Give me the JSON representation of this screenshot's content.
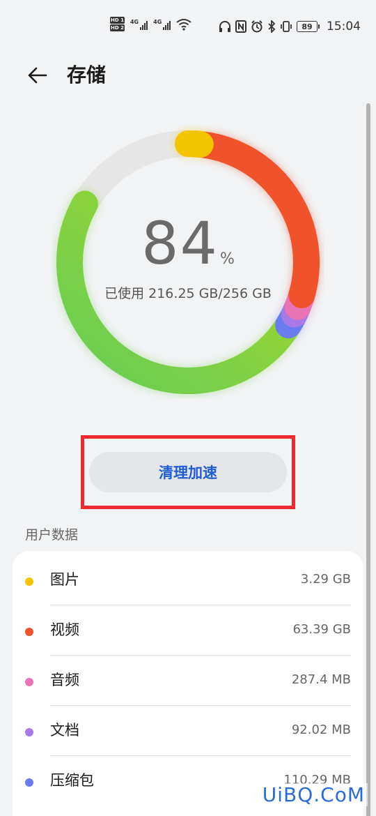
{
  "status_bar": {
    "sim1": "HD 1",
    "sim2": "HD 2",
    "net1": "4G",
    "net2": "4G",
    "battery": "89",
    "time": "15:04",
    "icons": [
      "headphones-icon",
      "nfc-icon",
      "alarm-icon",
      "bluetooth-icon",
      "vibrate-icon"
    ]
  },
  "header": {
    "title": "存储",
    "back_icon": "arrow-left-icon"
  },
  "storage": {
    "percent": "84",
    "percent_unit": "%",
    "used_label": "已使用 216.25 GB/256 GB",
    "used_fraction": 0.84
  },
  "clean_button": {
    "label": "清理加速"
  },
  "user_data": {
    "section_title": "用户数据",
    "items": [
      {
        "name": "图片",
        "size": "3.29 GB",
        "color": "#f5c400"
      },
      {
        "name": "视频",
        "size": "63.39 GB",
        "color": "#f0522b"
      },
      {
        "name": "音频",
        "size": "287.4 MB",
        "color": "#e873b5"
      },
      {
        "name": "文档",
        "size": "92.02 MB",
        "color": "#a77ae8"
      },
      {
        "name": "压缩包",
        "size": "110.29 MB",
        "color": "#6a7cf0"
      }
    ]
  },
  "ring_colors": {
    "track": "#e6e6e6",
    "images": "#f5c400",
    "videos": "#f0522b",
    "audio": "#e873b5",
    "docs": "#a77ae8",
    "archives": "#6a7cf0",
    "other_start": "#a6d82a",
    "other_end": "#66cc55"
  },
  "watermark": "UiBQ.CoM"
}
